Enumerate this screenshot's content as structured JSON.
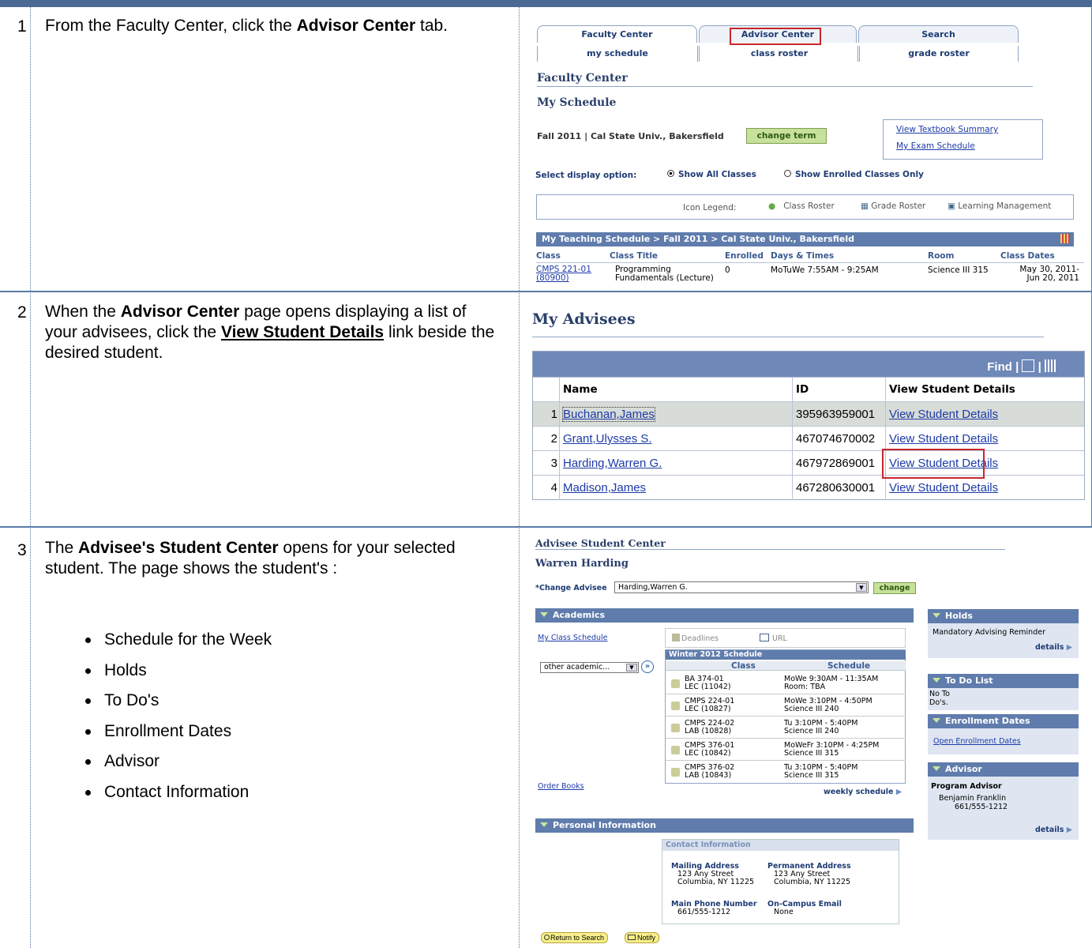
{
  "steps": [
    {
      "num": "1",
      "text_pre": "From the Faculty Center, click the ",
      "text_bold": "Advisor Center",
      "text_post": " tab."
    },
    {
      "num": "2",
      "text_pre": "When the ",
      "text_bold": "Advisor Center",
      "text_mid": " page opens displaying a list of your advisees, click the ",
      "text_link": "View Student Details",
      "text_post": " link beside the desired student."
    },
    {
      "num": "3",
      "text_pre": "The ",
      "text_bold": "Advisee's Student Center",
      "text_post": " opens for your selected student. The page shows the student's :",
      "bullets": [
        "Schedule for the Week",
        "Holds",
        "To Do's",
        "Enrollment Dates",
        "Advisor",
        "Contact Information"
      ]
    }
  ],
  "faculty": {
    "tabs": [
      "Faculty Center",
      "Advisor Center",
      "Search"
    ],
    "subtabs": [
      "my schedule",
      "class roster",
      "grade roster"
    ],
    "heading": "Faculty Center",
    "subheading": "My Schedule",
    "term": "Fall 2011 | Cal State Univ., Bakersfield",
    "change_term": "change term",
    "links": [
      "View Textbook Summary",
      "My Exam Schedule"
    ],
    "display_label": "Select display option:",
    "opt_all": "Show All Classes",
    "opt_enrolled": "Show Enrolled Classes Only",
    "legend_label": "Icon Legend:",
    "legend_items": [
      "Class Roster",
      "Grade Roster",
      "Learning Management"
    ],
    "grid_title": "My Teaching Schedule > Fall 2011 > Cal State Univ., Bakersfield",
    "cols": [
      "Class",
      "Class Title",
      "Enrolled",
      "Days & Times",
      "Room",
      "Class Dates"
    ],
    "row": {
      "class1": "CMPS 221-01",
      "class2": "(80900)",
      "title1": "Programming",
      "title2": "Fundamentals (Lecture)",
      "enrolled": "0",
      "days": "MoTuWe 7:55AM - 9:25AM",
      "room": "Science III 315",
      "dates1": "May 30, 2011-",
      "dates2": "Jun 20, 2011"
    }
  },
  "advisees": {
    "heading": "My Advisees",
    "find": "Find",
    "cols": [
      "Name",
      "ID",
      "View Student Details"
    ],
    "rows": [
      {
        "n": "1",
        "name": "Buchanan,James",
        "id": "395963959001",
        "link": "View Student Details"
      },
      {
        "n": "2",
        "name": "Grant,Ulysses S.",
        "id": "467074670002",
        "link": "View Student Details"
      },
      {
        "n": "3",
        "name": "Harding,Warren G.",
        "id": "467972869001",
        "link": "View Student Details"
      },
      {
        "n": "4",
        "name": "Madison,James",
        "id": "467280630001",
        "link": "View Student Details"
      }
    ]
  },
  "center": {
    "heading": "Advisee Student Center",
    "student": "Warren Harding",
    "change_label": "*Change Advisee",
    "advisee_value": "Harding,Warren G.",
    "change_btn": "change",
    "academics": "Academics",
    "my_class_schedule": "My Class Schedule",
    "deadlines": "Deadlines",
    "url": "URL",
    "other_academic": "other academic...",
    "schedule_title": "Winter 2012 Schedule",
    "sched_cols": [
      "Class",
      "Schedule"
    ],
    "classes": [
      {
        "c1": "BA 374-01",
        "c2": "LEC (11042)",
        "s1": "MoWe 9:30AM - 11:35AM",
        "s2": "Room:  TBA"
      },
      {
        "c1": "CMPS 224-01",
        "c2": "LEC (10827)",
        "s1": "MoWe 3:10PM - 4:50PM",
        "s2": "Science III 240"
      },
      {
        "c1": "CMPS 224-02",
        "c2": "LAB (10828)",
        "s1": "Tu 3:10PM - 5:40PM",
        "s2": "Science III 240"
      },
      {
        "c1": "CMPS 376-01",
        "c2": "LEC (10842)",
        "s1": "MoWeFr 3:10PM - 4:25PM",
        "s2": "Science III 315"
      },
      {
        "c1": "CMPS 376-02",
        "c2": "LAB (10843)",
        "s1": "Tu 3:10PM - 5:40PM",
        "s2": "Science III 315"
      }
    ],
    "order_books": "Order Books",
    "weekly_schedule": "weekly schedule",
    "holds": "Holds",
    "holds_text": "Mandatory Advising Reminder",
    "details": "details",
    "todo": "To Do List",
    "todo_text1": "No To",
    "todo_text2": "Do's.",
    "enroll": "Enrollment Dates",
    "enroll_link": "Open Enrollment Dates",
    "advisor": "Advisor",
    "advisor_type": "Program Advisor",
    "advisor_name": "Benjamin Franklin",
    "advisor_phone": "661/555-1212",
    "personal": "Personal Information",
    "contact": "Contact Information",
    "mailing": "Mailing Address",
    "mailing1": "123 Any Street",
    "mailing2": "Columbia, NY 11225",
    "permanent": "Permanent Address",
    "perm1": "123 Any Street",
    "perm2": "Columbia, NY 11225",
    "phone_label": "Main Phone Number",
    "phone": "661/555-1212",
    "email_label": "On-Campus Email",
    "email": "None",
    "return_btn": "Return to Search",
    "notify_btn": "Notify"
  }
}
